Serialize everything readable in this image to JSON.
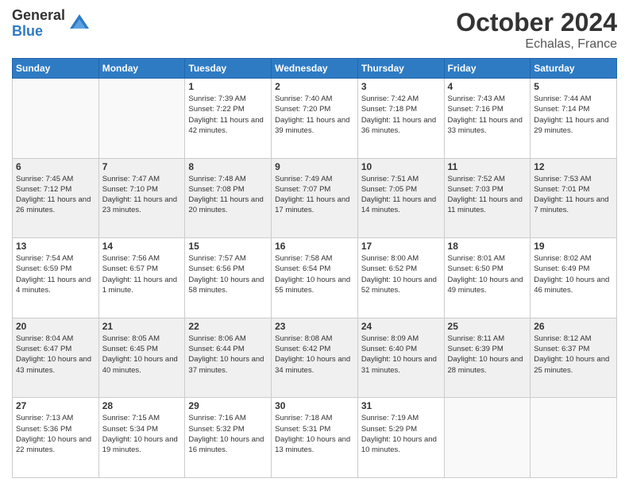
{
  "logo": {
    "general": "General",
    "blue": "Blue"
  },
  "header": {
    "title": "October 2024",
    "subtitle": "Echalas, France"
  },
  "days_of_week": [
    "Sunday",
    "Monday",
    "Tuesday",
    "Wednesday",
    "Thursday",
    "Friday",
    "Saturday"
  ],
  "weeks": [
    [
      {
        "day": "",
        "info": ""
      },
      {
        "day": "",
        "info": ""
      },
      {
        "day": "1",
        "info": "Sunrise: 7:39 AM\nSunset: 7:22 PM\nDaylight: 11 hours and 42 minutes."
      },
      {
        "day": "2",
        "info": "Sunrise: 7:40 AM\nSunset: 7:20 PM\nDaylight: 11 hours and 39 minutes."
      },
      {
        "day": "3",
        "info": "Sunrise: 7:42 AM\nSunset: 7:18 PM\nDaylight: 11 hours and 36 minutes."
      },
      {
        "day": "4",
        "info": "Sunrise: 7:43 AM\nSunset: 7:16 PM\nDaylight: 11 hours and 33 minutes."
      },
      {
        "day": "5",
        "info": "Sunrise: 7:44 AM\nSunset: 7:14 PM\nDaylight: 11 hours and 29 minutes."
      }
    ],
    [
      {
        "day": "6",
        "info": "Sunrise: 7:45 AM\nSunset: 7:12 PM\nDaylight: 11 hours and 26 minutes."
      },
      {
        "day": "7",
        "info": "Sunrise: 7:47 AM\nSunset: 7:10 PM\nDaylight: 11 hours and 23 minutes."
      },
      {
        "day": "8",
        "info": "Sunrise: 7:48 AM\nSunset: 7:08 PM\nDaylight: 11 hours and 20 minutes."
      },
      {
        "day": "9",
        "info": "Sunrise: 7:49 AM\nSunset: 7:07 PM\nDaylight: 11 hours and 17 minutes."
      },
      {
        "day": "10",
        "info": "Sunrise: 7:51 AM\nSunset: 7:05 PM\nDaylight: 11 hours and 14 minutes."
      },
      {
        "day": "11",
        "info": "Sunrise: 7:52 AM\nSunset: 7:03 PM\nDaylight: 11 hours and 11 minutes."
      },
      {
        "day": "12",
        "info": "Sunrise: 7:53 AM\nSunset: 7:01 PM\nDaylight: 11 hours and 7 minutes."
      }
    ],
    [
      {
        "day": "13",
        "info": "Sunrise: 7:54 AM\nSunset: 6:59 PM\nDaylight: 11 hours and 4 minutes."
      },
      {
        "day": "14",
        "info": "Sunrise: 7:56 AM\nSunset: 6:57 PM\nDaylight: 11 hours and 1 minute."
      },
      {
        "day": "15",
        "info": "Sunrise: 7:57 AM\nSunset: 6:56 PM\nDaylight: 10 hours and 58 minutes."
      },
      {
        "day": "16",
        "info": "Sunrise: 7:58 AM\nSunset: 6:54 PM\nDaylight: 10 hours and 55 minutes."
      },
      {
        "day": "17",
        "info": "Sunrise: 8:00 AM\nSunset: 6:52 PM\nDaylight: 10 hours and 52 minutes."
      },
      {
        "day": "18",
        "info": "Sunrise: 8:01 AM\nSunset: 6:50 PM\nDaylight: 10 hours and 49 minutes."
      },
      {
        "day": "19",
        "info": "Sunrise: 8:02 AM\nSunset: 6:49 PM\nDaylight: 10 hours and 46 minutes."
      }
    ],
    [
      {
        "day": "20",
        "info": "Sunrise: 8:04 AM\nSunset: 6:47 PM\nDaylight: 10 hours and 43 minutes."
      },
      {
        "day": "21",
        "info": "Sunrise: 8:05 AM\nSunset: 6:45 PM\nDaylight: 10 hours and 40 minutes."
      },
      {
        "day": "22",
        "info": "Sunrise: 8:06 AM\nSunset: 6:44 PM\nDaylight: 10 hours and 37 minutes."
      },
      {
        "day": "23",
        "info": "Sunrise: 8:08 AM\nSunset: 6:42 PM\nDaylight: 10 hours and 34 minutes."
      },
      {
        "day": "24",
        "info": "Sunrise: 8:09 AM\nSunset: 6:40 PM\nDaylight: 10 hours and 31 minutes."
      },
      {
        "day": "25",
        "info": "Sunrise: 8:11 AM\nSunset: 6:39 PM\nDaylight: 10 hours and 28 minutes."
      },
      {
        "day": "26",
        "info": "Sunrise: 8:12 AM\nSunset: 6:37 PM\nDaylight: 10 hours and 25 minutes."
      }
    ],
    [
      {
        "day": "27",
        "info": "Sunrise: 7:13 AM\nSunset: 5:36 PM\nDaylight: 10 hours and 22 minutes."
      },
      {
        "day": "28",
        "info": "Sunrise: 7:15 AM\nSunset: 5:34 PM\nDaylight: 10 hours and 19 minutes."
      },
      {
        "day": "29",
        "info": "Sunrise: 7:16 AM\nSunset: 5:32 PM\nDaylight: 10 hours and 16 minutes."
      },
      {
        "day": "30",
        "info": "Sunrise: 7:18 AM\nSunset: 5:31 PM\nDaylight: 10 hours and 13 minutes."
      },
      {
        "day": "31",
        "info": "Sunrise: 7:19 AM\nSunset: 5:29 PM\nDaylight: 10 hours and 10 minutes."
      },
      {
        "day": "",
        "info": ""
      },
      {
        "day": "",
        "info": ""
      }
    ]
  ]
}
